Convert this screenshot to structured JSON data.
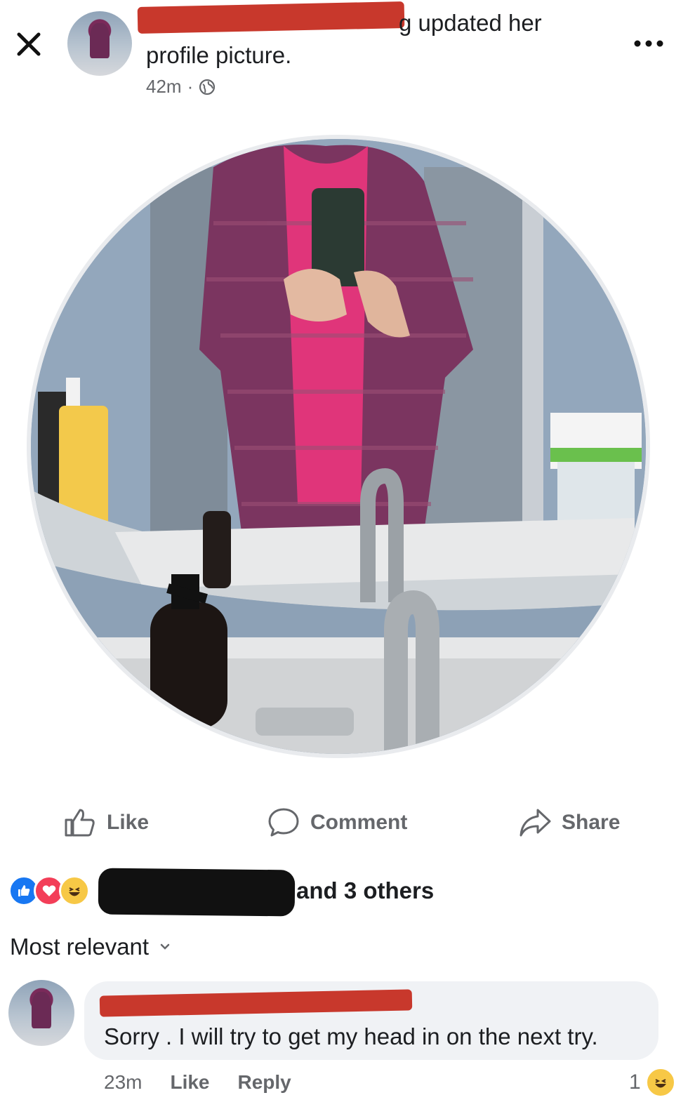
{
  "header": {
    "author_visible_text": "g updated her",
    "author_line2": "profile picture.",
    "timestamp": "42m",
    "separator": "·"
  },
  "actions": {
    "like": "Like",
    "comment": "Comment",
    "share": "Share"
  },
  "reactions": {
    "types": [
      "like",
      "love",
      "haha"
    ],
    "others_text": "and 3 others"
  },
  "comments_sort": {
    "label": "Most relevant"
  },
  "comment": {
    "text": "Sorry . I will try to get my head in on the next try.",
    "time": "23m",
    "like": "Like",
    "reply": "Reply",
    "reaction_count": "1"
  },
  "colors": {
    "redaction_red": "#c8382c",
    "redaction_black": "#111111",
    "meta_gray": "#65676b",
    "bubble_bg": "#f0f2f5"
  }
}
